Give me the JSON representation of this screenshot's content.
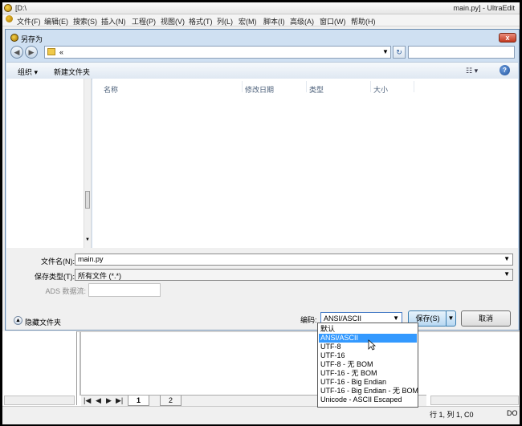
{
  "app": {
    "path": "[D:\\",
    "title": "main.py] - UltraEdit",
    "menu": [
      "文件(F)",
      "编辑(E)",
      "搜索(S)",
      "插入(N)",
      "工程(P)",
      "视图(V)",
      "格式(T)",
      "列(L)",
      "宏(M)",
      "脚本(I)",
      "高级(A)",
      "窗口(W)",
      "帮助(H)"
    ]
  },
  "dialog": {
    "title": "另存为",
    "close_label": "x",
    "address": "«",
    "toolbar": {
      "organize": "组织 ▾",
      "new_folder": "新建文件夹"
    },
    "columns": [
      "名称",
      "修改日期",
      "类型",
      "大小"
    ],
    "filename_label": "文件名(N):",
    "filename_value": "main.py",
    "filetype_label": "保存类型(T):",
    "filetype_value": "所有文件 (*.*)",
    "ads_label": "ADS 数据流:",
    "ads_value": "",
    "hide_folders": "隐藏文件夹",
    "encoding_label": "编码:",
    "encoding_value": "ANSI/ASCII",
    "save_label": "保存(S)",
    "cancel_label": "取消"
  },
  "encoding_options": [
    "默认",
    "ANSI/ASCII",
    "UTF-8",
    "UTF-16",
    "UTF-8 - 无 BOM",
    "UTF-16 - 无 BOM",
    "UTF-16 - Big Endian",
    "UTF-16 - Big Endian  - 无 BOM",
    "Unicode - ASCII Escaped"
  ],
  "encoding_selected_index": 1,
  "editor": {
    "tabs": [
      "1",
      "2"
    ],
    "status_position": "行 1, 列 1, C0",
    "status_encoding": "DO"
  }
}
